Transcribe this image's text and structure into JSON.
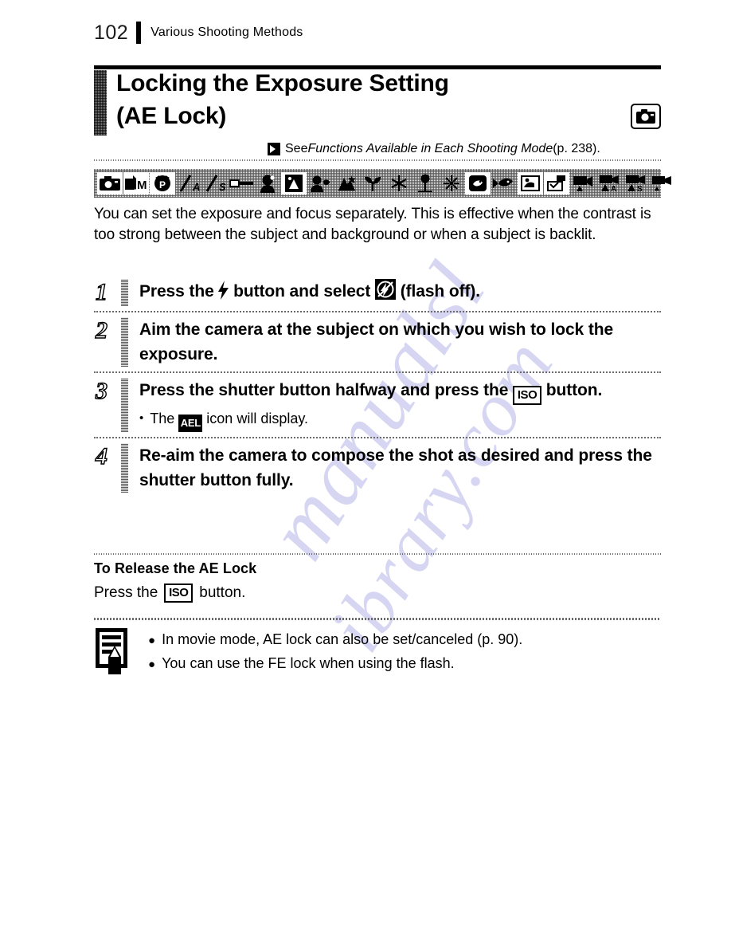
{
  "header": {
    "page_number": "102",
    "chapter_title": "Various Shooting Methods"
  },
  "title": {
    "line1": "Locking the Exposure Setting",
    "line2": "(AE Lock)",
    "badge_icon": "camera-icon"
  },
  "reference": {
    "icon": "arrow-right-icon",
    "prefix": "See ",
    "italic": "Functions Available in Each Shooting Mode",
    "suffix": " (p. 238)."
  },
  "mode_strip": {
    "icons": [
      "camera-auto-icon",
      "manual-m-icon",
      "portrait-p-icon",
      "auto-a-icon",
      "auto-s-icon",
      "stitch-assist-icon",
      "portrait-head-icon",
      "night-scene-icon",
      "kids-and-pets-icon",
      "indoor-icon",
      "foliage-icon",
      "snow-icon",
      "beach-icon",
      "fireworks-icon",
      "aquarium-icon",
      "underwater-icon",
      "iso-high-icon",
      "color-accent-icon",
      "movie-standard-icon",
      "movie-a-icon",
      "movie-s-icon",
      "movie-compact-icon"
    ]
  },
  "intro": "You can set the exposure and focus separately. This is effective when the contrast is too strong between the subject and background or when a subject is backlit.",
  "steps": [
    {
      "number": "1",
      "text_before": "Press the ",
      "icon1": "flash-icon",
      "text_middle": " button and select ",
      "icon2": "flash-off-icon",
      "text_after": " (flash off).",
      "note_bullet": "",
      "note_text": ""
    },
    {
      "number": "2",
      "text_before": "Aim the camera at the subject on which you wish to lock the exposure.",
      "icon1": "",
      "text_middle": "",
      "icon2": "",
      "text_after": "",
      "note_bullet": "",
      "note_text": ""
    },
    {
      "number": "3",
      "text_before": "Press the shutter button halfway and press the ",
      "icon1": "iso-button-icon",
      "text_middle": " button.",
      "icon2": "",
      "text_after": "",
      "note_bullet": "•",
      "note_prefix": "The ",
      "note_icon": "ael-icon",
      "note_suffix": " icon will display."
    },
    {
      "number": "4",
      "text_before": "Re-aim the camera to compose the shot as desired and press the shutter button fully.",
      "icon1": "",
      "text_middle": "",
      "icon2": "",
      "text_after": "",
      "note_bullet": "",
      "note_text": ""
    }
  ],
  "release": {
    "title": "To Release the AE Lock",
    "text_before": "Press the",
    "icon": "iso-button-icon",
    "text_after": "button."
  },
  "note_box": {
    "icon": "note-pencil-icon",
    "items": [
      {
        "bullet": "●",
        "text": "In movie mode, AE lock can also be set/canceled (p. 90)."
      },
      {
        "bullet": "●",
        "text": "You can use the FE lock when using the flash."
      }
    ]
  },
  "watermark": {
    "line1": "manualsl",
    "line2": "ibrary.com"
  },
  "colors": {
    "text": "#000000",
    "background": "#ffffff",
    "rule": "#6b6b6b",
    "watermark": "#c9c9ef"
  }
}
